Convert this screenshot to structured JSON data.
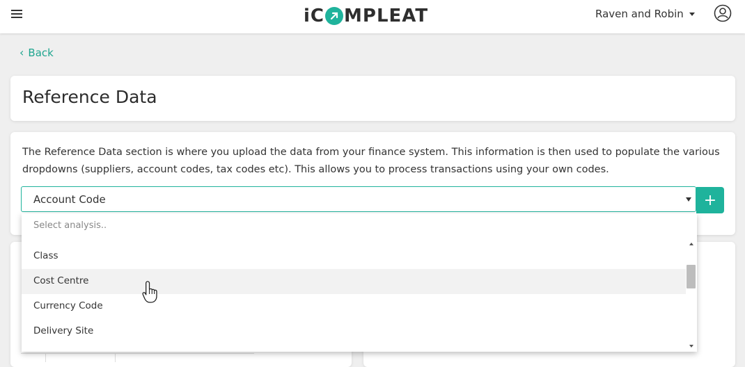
{
  "header": {
    "logo_text": "iCOMPLEAT",
    "user_name": "Raven and Robin"
  },
  "nav": {
    "back_label": "Back"
  },
  "page": {
    "title": "Reference Data",
    "description": "The Reference Data section is where you upload the data from your finance system. This information is then used to populate the various dropdowns (suppliers, account codes, tax codes etc). This allows you to process transactions using your own codes."
  },
  "analysis_select": {
    "selected_value": "Account Code",
    "search_placeholder": "Select analysis..",
    "options": [
      "Class",
      "Cost Centre",
      "Currency Code",
      "Delivery Site"
    ],
    "hovered_option": "Cost Centre"
  },
  "add_button": {
    "label": "+"
  },
  "colors": {
    "accent": "#1fb39c",
    "link": "#1fa58f",
    "background": "#efefef"
  },
  "icons": [
    "hamburger-menu-icon",
    "user-avatar-icon",
    "chevron-left-icon",
    "caret-down-icon",
    "plus-icon",
    "hand-pointer-icon"
  ]
}
